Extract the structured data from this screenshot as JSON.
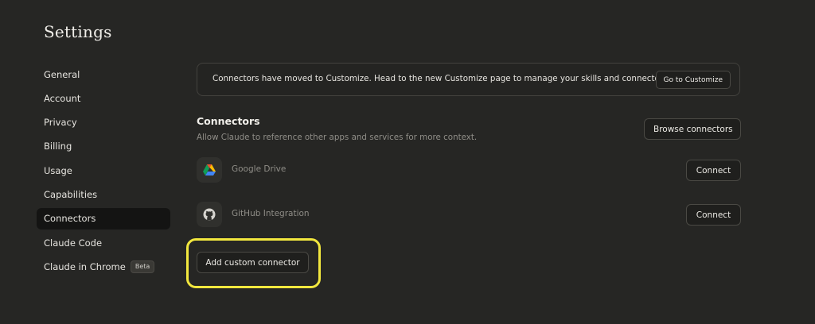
{
  "page": {
    "title": "Settings"
  },
  "sidebar": {
    "items": [
      {
        "label": "General"
      },
      {
        "label": "Account"
      },
      {
        "label": "Privacy"
      },
      {
        "label": "Billing"
      },
      {
        "label": "Usage"
      },
      {
        "label": "Capabilities"
      },
      {
        "label": "Connectors",
        "active": true
      },
      {
        "label": "Claude Code"
      },
      {
        "label": "Claude in Chrome",
        "badge": "Beta"
      }
    ]
  },
  "banner": {
    "text": "Connectors have moved to Customize. Head to the new Customize page to manage your skills and connectors.",
    "button_label": "Go to Customize"
  },
  "connectors": {
    "title": "Connectors",
    "description": "Allow Claude to reference other apps and services for more context.",
    "browse_label": "Browse connectors",
    "items": [
      {
        "name": "Google Drive",
        "icon": "google-drive-icon",
        "button_label": "Connect"
      },
      {
        "name": "GitHub Integration",
        "icon": "github-icon",
        "button_label": "Connect"
      }
    ],
    "add_custom_label": "Add custom connector"
  },
  "colors": {
    "background": "#262624",
    "highlight": "#f2e73e",
    "active_nav": "#141413"
  }
}
